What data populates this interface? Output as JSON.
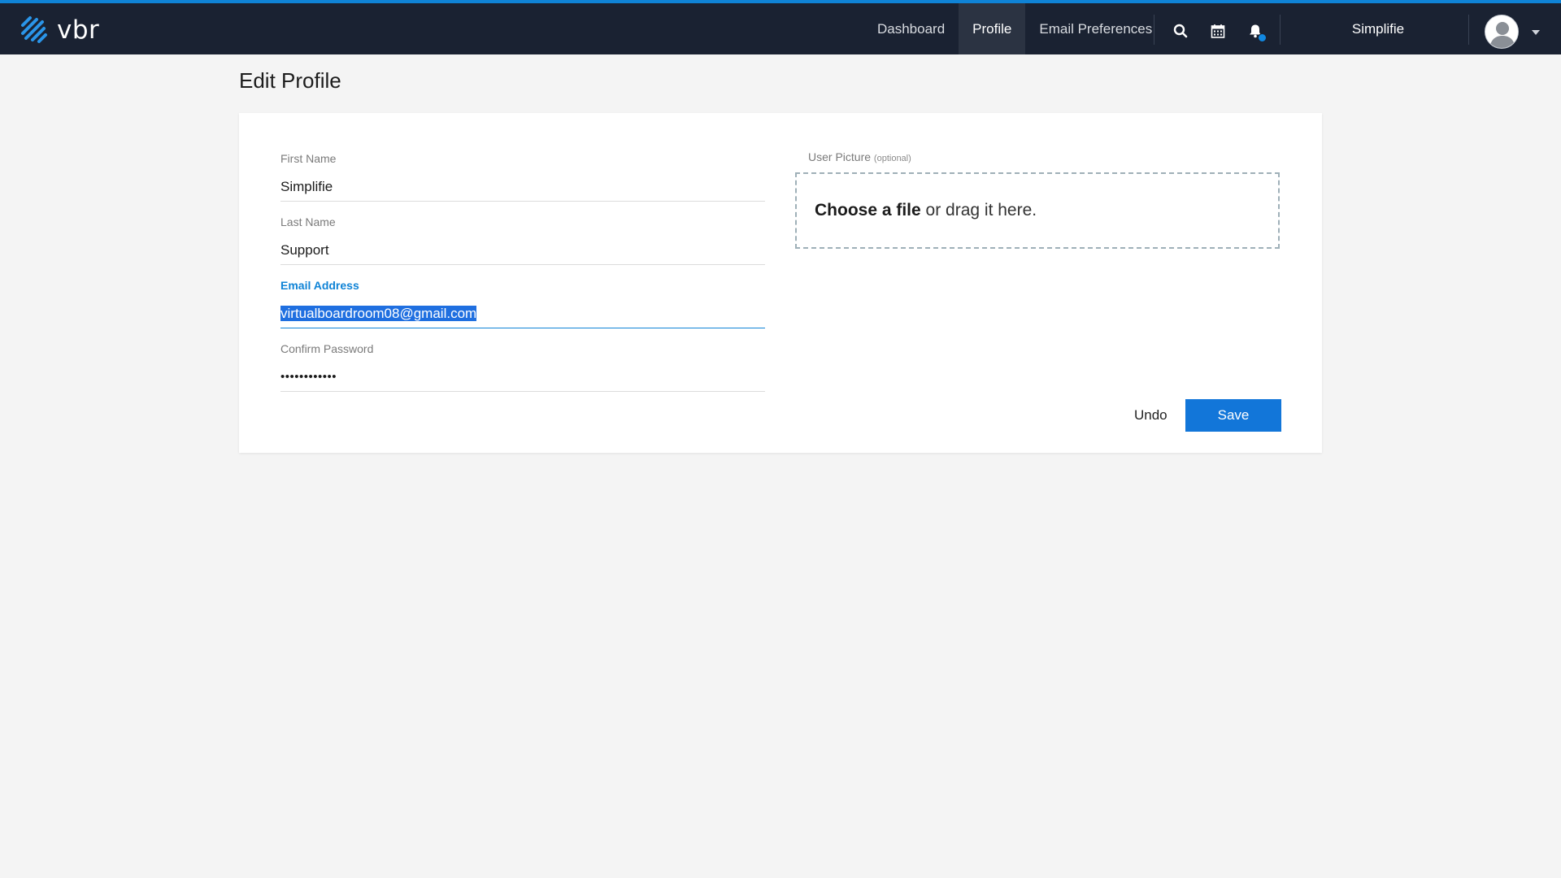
{
  "brand": {
    "name": "vbr",
    "accent": "#0f83d6",
    "nav_bg": "#1a2232"
  },
  "nav": {
    "items": [
      {
        "label": "Dashboard",
        "active": false
      },
      {
        "label": "Profile",
        "active": true
      },
      {
        "label": "Email Preferences",
        "active": false
      }
    ],
    "icons": [
      "search-icon",
      "calendar-icon",
      "bell-icon"
    ],
    "user_name": "Simplifie"
  },
  "page": {
    "title": "Edit Profile"
  },
  "form": {
    "first_name": {
      "label": "First Name",
      "value": "Simplifie"
    },
    "last_name": {
      "label": "Last Name",
      "value": "Support"
    },
    "email": {
      "label": "Email Address",
      "value": "virtualboardroom08@gmail.com"
    },
    "confirm_password": {
      "label": "Confirm Password",
      "value": "••••••••••••"
    },
    "picture": {
      "label": "User Picture",
      "optional": "(optional)",
      "choose": "Choose a file",
      "drag": " or drag it here."
    },
    "undo_label": "Undo",
    "save_label": "Save"
  }
}
